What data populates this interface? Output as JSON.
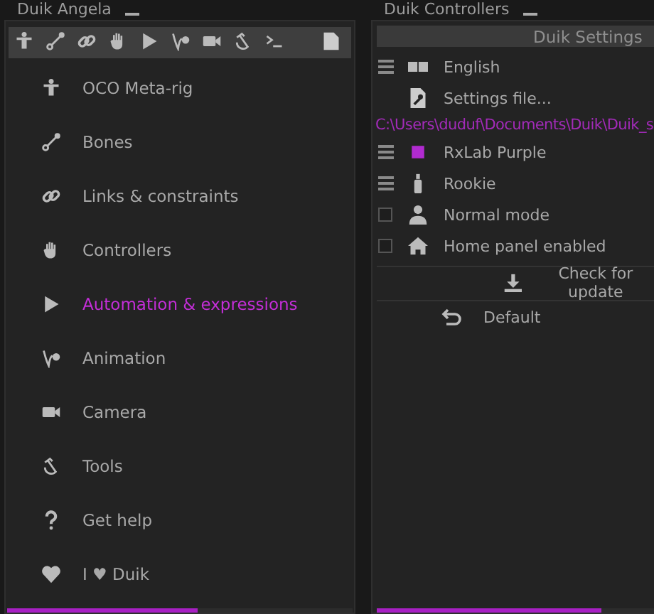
{
  "left_panel": {
    "title": "Duik Angela",
    "menu": [
      {
        "label": "OCO Meta-rig",
        "selected": false
      },
      {
        "label": "Bones",
        "selected": false
      },
      {
        "label": "Links & constraints",
        "selected": false
      },
      {
        "label": "Controllers",
        "selected": false
      },
      {
        "label": "Automation & expressions",
        "selected": true
      },
      {
        "label": "Animation",
        "selected": false
      },
      {
        "label": "Camera",
        "selected": false
      },
      {
        "label": "Tools",
        "selected": false
      },
      {
        "label": "Get help",
        "selected": false
      },
      {
        "label": "I ♥ Duik",
        "selected": false
      }
    ],
    "progress": {
      "level": 0.55
    }
  },
  "right_panel": {
    "title": "Duik Controllers",
    "header": "Duik Settings",
    "rows": [
      {
        "kind": "menu",
        "label": "English"
      },
      {
        "kind": "button",
        "label": "Settings file..."
      },
      {
        "kind": "path",
        "label": "C:\\Users\\duduf\\Documents\\Duik\\Duik_s"
      },
      {
        "kind": "menu",
        "label": "RxLab Purple",
        "color": "#b12bd0"
      },
      {
        "kind": "menu",
        "label": "Rookie"
      },
      {
        "kind": "checkbox",
        "label": "Normal mode",
        "checked": false
      },
      {
        "kind": "checkbox",
        "label": "Home panel enabled",
        "checked": false
      }
    ],
    "update_button": "Check for update",
    "default_button": "Default",
    "progress": {
      "level": 0.81
    }
  }
}
